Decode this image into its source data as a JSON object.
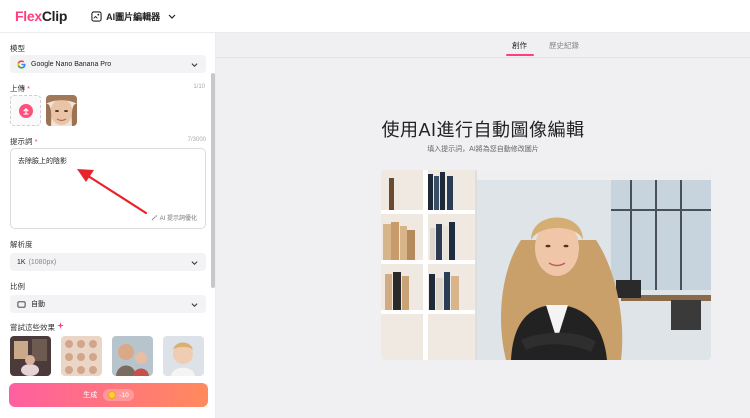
{
  "header": {
    "logo_part1": "Flex",
    "logo_part2": "Clip",
    "tool_name": "AI圖片編輯器"
  },
  "panel": {
    "model": {
      "label": "模型",
      "value": "Google Nano Banana Pro"
    },
    "upload": {
      "label": "上傳",
      "required_mark": "*",
      "counter": "1/10"
    },
    "prompt": {
      "label": "提示詞",
      "required_mark": "*",
      "counter": "7/3000",
      "value": "去除臉上的陰影",
      "optimize_label": "AI 提示詞優化"
    },
    "resolution": {
      "label": "解析度",
      "value": "1K",
      "value_detail": "(1080px)"
    },
    "ratio": {
      "label": "比例",
      "value": "自動"
    },
    "effects": {
      "label": "嘗試這些效果"
    },
    "generate": {
      "label": "生成",
      "cost": "-10"
    }
  },
  "main": {
    "tabs": [
      {
        "label": "創作",
        "active": true
      },
      {
        "label": "歷史紀錄",
        "active": false
      }
    ],
    "headline": "使用AI進行自動圖像編輯",
    "subline": "填入提示詞，AI將為您自動修改圖片"
  },
  "colors": {
    "accent": "#ff3d7f",
    "annotation_arrow": "#e8232a"
  }
}
